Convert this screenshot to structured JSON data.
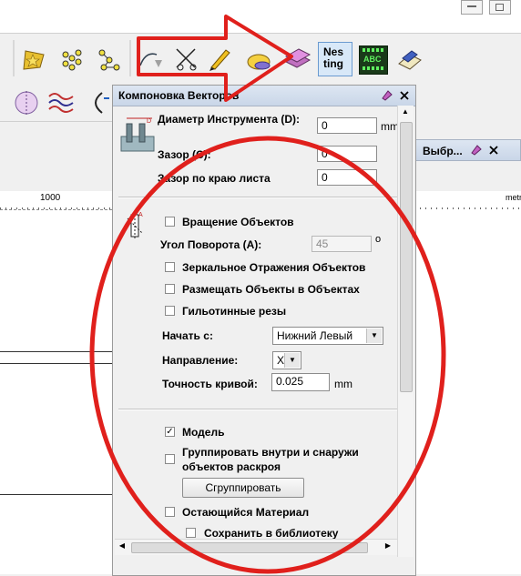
{
  "panel": {
    "title": "Компоновка Векторов",
    "tool_diameter_label": "Диаметр Инструмента (D):",
    "tool_diameter_value": "0",
    "tool_diameter_unit": "mm",
    "gap_label": "Зазор (С):",
    "gap_value": "0",
    "edge_gap_label": "Зазор по краю листа",
    "edge_gap_value": "0",
    "rotate_label": "Вращение Объектов",
    "rotate_checked": false,
    "angle_label": "Угол Поворота (А):",
    "angle_value": "45",
    "angle_unit": "o",
    "mirror_label": "Зеркальное Отражения Объектов",
    "place_in_label": "Размещать Объекты в Объектах",
    "guillotine_label": "Гильотинные резы",
    "start_label": "Начать с:",
    "start_value": "Нижний Левый",
    "direction_label": "Направление:",
    "direction_value": "X",
    "precision_label": "Точность кривой:",
    "precision_value": "0.025",
    "precision_unit": "mm",
    "model_label": "Модель",
    "model_checked": true,
    "group_label_1": "Группировать внутри и снаружи",
    "group_label_2": "объектов раскроя",
    "group_button": "Сгруппировать",
    "remnant_label": "Остающийся Материал",
    "save_lib_label": "Сохранить в библиотеку"
  },
  "side_panel": {
    "title": "Выбр..."
  },
  "ruler": {
    "tick_label": "1000",
    "unit_label": "metr"
  },
  "toolbar": {
    "nesting_icon_text_1": "Nes",
    "nesting_icon_text_2": "ting",
    "abc_icon_text": "ABC"
  },
  "colors": {
    "annotation_red": "#e0201c",
    "panel_header": "#c9d6e8"
  }
}
